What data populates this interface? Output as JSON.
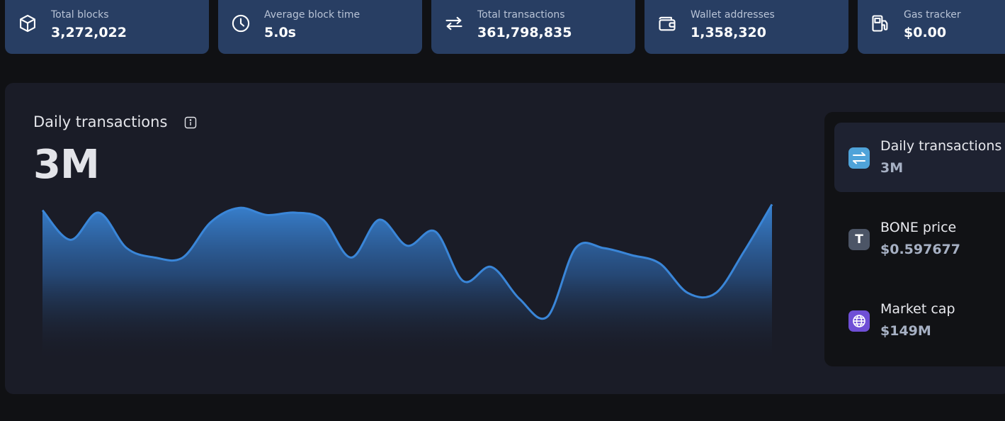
{
  "stats": [
    {
      "label": "Total blocks",
      "value": "3,272,022",
      "icon": "cube-icon"
    },
    {
      "label": "Average block time",
      "value": "5.0s",
      "icon": "clock-icon"
    },
    {
      "label": "Total transactions",
      "value": "361,798,835",
      "icon": "arrows-swap-icon"
    },
    {
      "label": "Wallet addresses",
      "value": "1,358,320",
      "icon": "wallet-icon"
    },
    {
      "label": "Gas tracker",
      "value": "$0.00",
      "icon": "gas-pump-icon"
    }
  ],
  "chart": {
    "title": "Daily transactions",
    "big_value": "3M"
  },
  "side": [
    {
      "label": "Daily transactions",
      "value": "3M",
      "icon": "swap-icon",
      "icon_color": "#4fa3d9"
    },
    {
      "label": "BONE price",
      "value": "$0.597677",
      "icon": "token-icon",
      "icon_letter": "T",
      "icon_color": "#4c5566"
    },
    {
      "label": "Market cap",
      "value": "$149M",
      "icon": "globe-icon",
      "icon_color": "#6f4fd6"
    }
  ],
  "colors": {
    "card_bg": "#283e63",
    "panel_bg": "#1a1c27",
    "line": "#3a86d8",
    "page_bg": "#101114"
  },
  "chart_data": {
    "type": "area",
    "title": "Daily transactions",
    "xlabel": "",
    "ylabel": "",
    "values": [
      2.8,
      2.55,
      2.78,
      2.48,
      2.4,
      2.4,
      2.7,
      2.82,
      2.76,
      2.78,
      2.72,
      2.4,
      2.72,
      2.5,
      2.62,
      2.2,
      2.32,
      2.05,
      1.9,
      2.48,
      2.48,
      2.42,
      2.35,
      2.1,
      2.1,
      2.45,
      2.85
    ],
    "ylim": [
      0,
      3
    ]
  }
}
